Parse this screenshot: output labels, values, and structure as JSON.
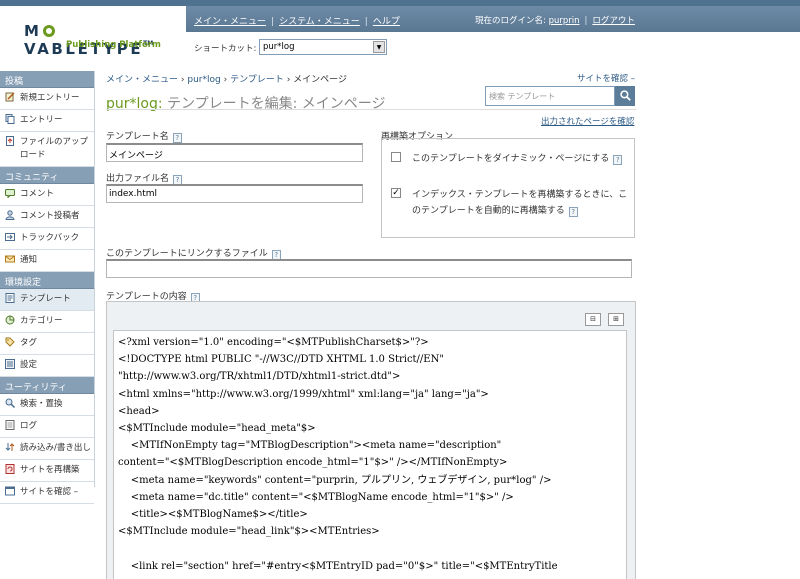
{
  "header": {
    "logo_main": "MOVABLETYPE",
    "logo_tm": "TM",
    "logo_sub": "Publishing Platform",
    "nav": [
      "メイン・メニュー",
      "システム・メニュー",
      "ヘルプ"
    ],
    "login_prefix": "現在のログイン名:",
    "login_user": "purprin",
    "logout": "ログアウト",
    "shortcut_label": "ショートカット:",
    "shortcut_value": "pur*log"
  },
  "sidebar": [
    {
      "section": "投稿",
      "items": [
        {
          "label": "新規エントリー",
          "icon": "new-entry-icon"
        },
        {
          "label": "エントリー",
          "icon": "entries-icon"
        },
        {
          "label": "ファイルのアップロード",
          "icon": "upload-file-icon"
        }
      ]
    },
    {
      "section": "コミュニティ",
      "items": [
        {
          "label": "コメント",
          "icon": "comment-icon"
        },
        {
          "label": "コメント投稿者",
          "icon": "commenter-icon"
        },
        {
          "label": "トラックバック",
          "icon": "trackback-icon"
        },
        {
          "label": "通知",
          "icon": "notification-icon"
        }
      ]
    },
    {
      "section": "環境設定",
      "items": [
        {
          "label": "テンプレート",
          "icon": "template-icon",
          "active": true
        },
        {
          "label": "カテゴリー",
          "icon": "category-icon"
        },
        {
          "label": "タグ",
          "icon": "tag-icon"
        },
        {
          "label": "設定",
          "icon": "settings-icon"
        }
      ]
    },
    {
      "section": "ユーティリティ",
      "items": [
        {
          "label": "検索・置換",
          "icon": "search-replace-icon"
        },
        {
          "label": "ログ",
          "icon": "log-icon"
        },
        {
          "label": "読み込み/書き出し",
          "icon": "import-export-icon"
        },
        {
          "label": "サイトを再構築",
          "icon": "rebuild-icon"
        },
        {
          "label": "サイトを確認 –",
          "icon": "view-site-icon"
        }
      ]
    }
  ],
  "breadcrumb": {
    "main": "メイン・メニュー",
    "blog": "pur*log",
    "templates": "テンプレート",
    "current": "メインページ"
  },
  "view_site": "サイトを確認 –",
  "page_title": {
    "blog": "pur*log:",
    "rest": " テンプレートを編集: メインページ"
  },
  "search_placeholder": "検索 テンプレート",
  "published_page_link": "出力されたページを確認",
  "form": {
    "template_name_label": "テンプレート名",
    "template_name_value": "メインページ",
    "output_file_label": "出力ファイル名",
    "output_file_value": "index.html",
    "rebuild_options_label": "再構築オプション",
    "dynamic_label": "このテンプレートをダイナミック・ページにする",
    "dynamic_checked": false,
    "rebuild_index_label": "インデックス・テンプレートを再構築するときに、このテンプレートを自動的に再構築する",
    "rebuild_index_checked": true,
    "link_file_label": "このテンプレートにリンクするファイル",
    "link_file_value": "",
    "body_label": "テンプレートの内容"
  },
  "help_mark": "?",
  "template_body": "<?xml version=\"1.0\" encoding=\"<$MTPublishCharset$>\"?>\n<!DOCTYPE html PUBLIC \"-//W3C//DTD XHTML 1.0 Strict//EN\"\n\"http://www.w3.org/TR/xhtml1/DTD/xhtml1-strict.dtd\">\n<html xmlns=\"http://www.w3.org/1999/xhtml\" xml:lang=\"ja\" lang=\"ja\">\n<head>\n<$MTInclude module=\"head_meta\"$>\n    <MTIfNonEmpty tag=\"MTBlogDescription\"><meta name=\"description\"\ncontent=\"<$MTBlogDescription encode_html=\"1\"$>\" /></MTIfNonEmpty>\n    <meta name=\"keywords\" content=\"purprin, プルプリン, ウェブデザイン, pur*log\" />\n    <meta name=\"dc.title\" content=\"<$MTBlogName encode_html=\"1\"$>\" />\n    <title><$MTBlogName$></title>\n<$MTInclude module=\"head_link\"$><MTEntries>\n\n    <link rel=\"section\" href=\"#entry<$MTEntryID pad=\"0\"$>\" title=\"<$MTEntryTitle"
}
